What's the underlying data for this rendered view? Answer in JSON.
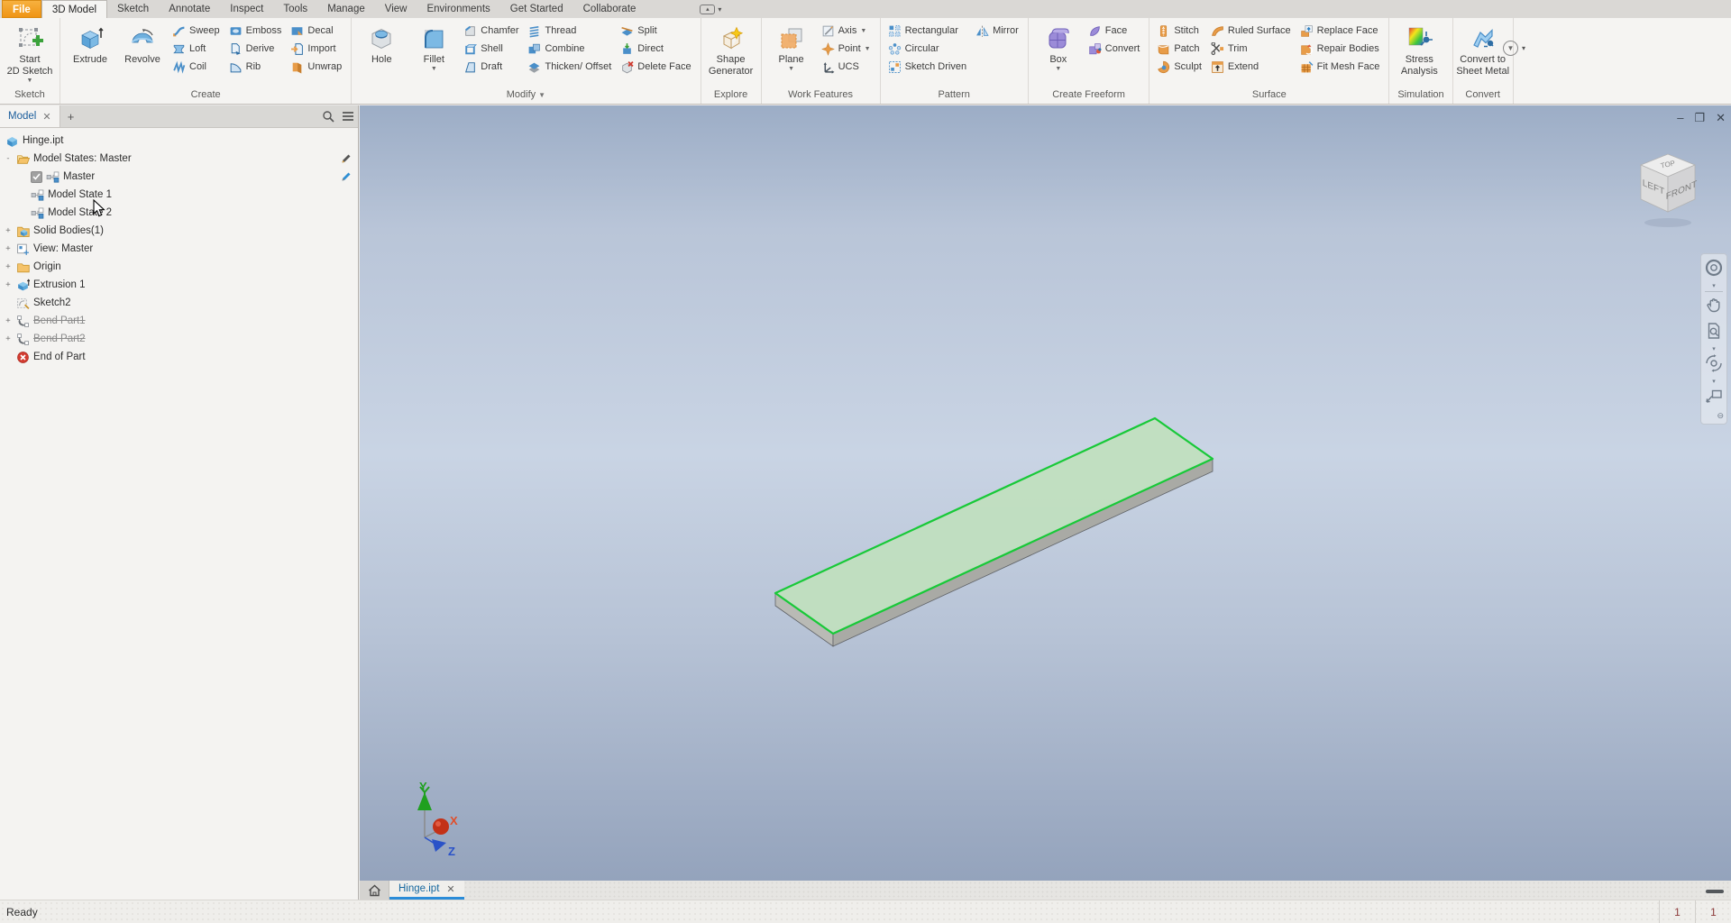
{
  "menubar": {
    "tabs": [
      "File",
      "3D Model",
      "Sketch",
      "Annotate",
      "Inspect",
      "Tools",
      "Manage",
      "View",
      "Environments",
      "Get Started",
      "Collaborate"
    ],
    "active_tab": "3D Model"
  },
  "ribbon": {
    "groups": [
      {
        "label": "Sketch",
        "items": [
          {
            "type": "big",
            "lines": [
              "Start",
              "2D Sketch"
            ],
            "icon": "start-2d-sketch",
            "caret": true
          }
        ]
      },
      {
        "label": "Create",
        "items": [
          {
            "type": "big",
            "lines": [
              "Extrude"
            ],
            "icon": "extrude"
          },
          {
            "type": "big",
            "lines": [
              "Revolve"
            ],
            "icon": "revolve"
          },
          {
            "type": "col",
            "buttons": [
              {
                "label": "Sweep",
                "icon": "sweep"
              },
              {
                "label": "Loft",
                "icon": "loft"
              },
              {
                "label": "Coil",
                "icon": "coil"
              }
            ]
          },
          {
            "type": "col",
            "buttons": [
              {
                "label": "Emboss",
                "icon": "emboss"
              },
              {
                "label": "Derive",
                "icon": "derive"
              },
              {
                "label": "Rib",
                "icon": "rib"
              }
            ]
          },
          {
            "type": "col",
            "buttons": [
              {
                "label": "Decal",
                "icon": "decal"
              },
              {
                "label": "Import",
                "icon": "import"
              },
              {
                "label": "Unwrap",
                "icon": "unwrap"
              }
            ]
          }
        ]
      },
      {
        "label": "Modify",
        "label_caret": true,
        "items": [
          {
            "type": "big",
            "lines": [
              "Hole"
            ],
            "icon": "hole"
          },
          {
            "type": "big",
            "lines": [
              "Fillet"
            ],
            "icon": "fillet",
            "caret": true
          },
          {
            "type": "col",
            "buttons": [
              {
                "label": "Chamfer",
                "icon": "chamfer"
              },
              {
                "label": "Shell",
                "icon": "shell"
              },
              {
                "label": "Draft",
                "icon": "draft"
              }
            ]
          },
          {
            "type": "col",
            "buttons": [
              {
                "label": "Thread",
                "icon": "thread"
              },
              {
                "label": "Combine",
                "icon": "combine"
              },
              {
                "label": "Thicken/ Offset",
                "icon": "thicken-offset"
              }
            ]
          },
          {
            "type": "col",
            "buttons": [
              {
                "label": "Split",
                "icon": "split"
              },
              {
                "label": "Direct",
                "icon": "direct"
              },
              {
                "label": "Delete Face",
                "icon": "delete-face"
              }
            ]
          }
        ]
      },
      {
        "label": "Explore",
        "items": [
          {
            "type": "big",
            "lines": [
              "Shape",
              "Generator"
            ],
            "icon": "shape-generator"
          }
        ]
      },
      {
        "label": "Work Features",
        "items": [
          {
            "type": "big",
            "lines": [
              "Plane"
            ],
            "icon": "plane",
            "caret": true
          },
          {
            "type": "col",
            "buttons": [
              {
                "label": "Axis",
                "icon": "axis",
                "caret": true
              },
              {
                "label": "Point",
                "icon": "point",
                "caret": true
              },
              {
                "label": "UCS",
                "icon": "ucs"
              }
            ]
          }
        ]
      },
      {
        "label": "Pattern",
        "items": [
          {
            "type": "col",
            "buttons": [
              {
                "label": "Rectangular",
                "icon": "rectangular-pattern"
              },
              {
                "label": "Circular",
                "icon": "circular-pattern"
              },
              {
                "label": "Sketch Driven",
                "icon": "sketch-driven-pattern"
              }
            ]
          },
          {
            "type": "col",
            "buttons": [
              {
                "label": "Mirror",
                "icon": "mirror"
              }
            ]
          }
        ]
      },
      {
        "label": "Create Freeform",
        "items": [
          {
            "type": "big",
            "lines": [
              "Box"
            ],
            "icon": "freeform-box",
            "caret": true
          },
          {
            "type": "col",
            "buttons": [
              {
                "label": "Face",
                "icon": "freeform-face"
              },
              {
                "label": "Convert",
                "icon": "freeform-convert"
              }
            ]
          }
        ]
      },
      {
        "label": "Surface",
        "items": [
          {
            "type": "col",
            "buttons": [
              {
                "label": "Stitch",
                "icon": "stitch"
              },
              {
                "label": "Patch",
                "icon": "patch"
              },
              {
                "label": "Sculpt",
                "icon": "sculpt"
              }
            ]
          },
          {
            "type": "col",
            "buttons": [
              {
                "label": "Ruled Surface",
                "icon": "ruled-surface"
              },
              {
                "label": "Trim",
                "icon": "trim"
              },
              {
                "label": "Extend",
                "icon": "extend"
              }
            ]
          },
          {
            "type": "col",
            "buttons": [
              {
                "label": "Replace Face",
                "icon": "replace-face"
              },
              {
                "label": "Repair Bodies",
                "icon": "repair-bodies"
              },
              {
                "label": "Fit Mesh Face",
                "icon": "fit-mesh-face"
              }
            ]
          }
        ]
      },
      {
        "label": "Simulation",
        "items": [
          {
            "type": "big",
            "lines": [
              "Stress",
              "Analysis"
            ],
            "icon": "stress-analysis"
          }
        ]
      },
      {
        "label": "Convert",
        "items": [
          {
            "type": "big",
            "lines": [
              "Convert to",
              "Sheet Metal"
            ],
            "icon": "convert-sheet-metal"
          }
        ]
      }
    ]
  },
  "browser": {
    "panel_tab": "Model",
    "add_tab": "+",
    "tree": [
      {
        "label": "Hinge.ipt",
        "level": 0,
        "icon": "part-document"
      },
      {
        "label": "Model States: Master",
        "level": 1,
        "exp": "-",
        "icon": "folder-open",
        "pencil": "dark"
      },
      {
        "label": "Master",
        "level": 2,
        "checkbox": true,
        "icon": "model-state",
        "pencil": "blue"
      },
      {
        "label": "Model State 1",
        "level": 2,
        "icon": "model-state"
      },
      {
        "label": "Model State 2",
        "level": 2,
        "icon": "model-state"
      },
      {
        "label": "Solid Bodies(1)",
        "level": 1,
        "exp": "+",
        "icon": "solid-bodies-folder"
      },
      {
        "label": "View: Master",
        "level": 1,
        "exp": "+",
        "icon": "view-rep"
      },
      {
        "label": "Origin",
        "level": 1,
        "exp": "+",
        "icon": "folder"
      },
      {
        "label": "Extrusion 1",
        "level": 1,
        "exp": "+",
        "icon": "extrusion"
      },
      {
        "label": "Sketch2",
        "level": 1,
        "icon": "sketch"
      },
      {
        "label": "Bend Part1",
        "level": 1,
        "exp": "+",
        "icon": "bend",
        "strike": true
      },
      {
        "label": "Bend Part2",
        "level": 1,
        "exp": "+",
        "icon": "bend",
        "strike": true
      },
      {
        "label": "End of Part",
        "level": 1,
        "icon": "end-of-part"
      }
    ]
  },
  "viewport": {
    "viewcube_faces": {
      "top": "TOP",
      "left": "LEFT",
      "front": "FRONT"
    },
    "triad_axes": {
      "x": "X",
      "y": "Y",
      "z": "Z"
    },
    "window_controls": {
      "minimize": "–",
      "restore": "❐",
      "close": "✕"
    },
    "navbar_tools": [
      "navigation-wheel",
      "pan",
      "zoom-window",
      "orbit",
      "look-at"
    ]
  },
  "document_tabs": {
    "active_label": "Hinge.ipt",
    "close": "✕"
  },
  "statusbar": {
    "message": "Ready",
    "cells": [
      "1",
      "1"
    ]
  },
  "colors": {
    "selection_green": "#18c938",
    "part_top_face": "#c0dfbe",
    "part_side": "#a9aaa5",
    "file_button": "#f09a1a",
    "tab_underline": "#2b8cd8"
  }
}
